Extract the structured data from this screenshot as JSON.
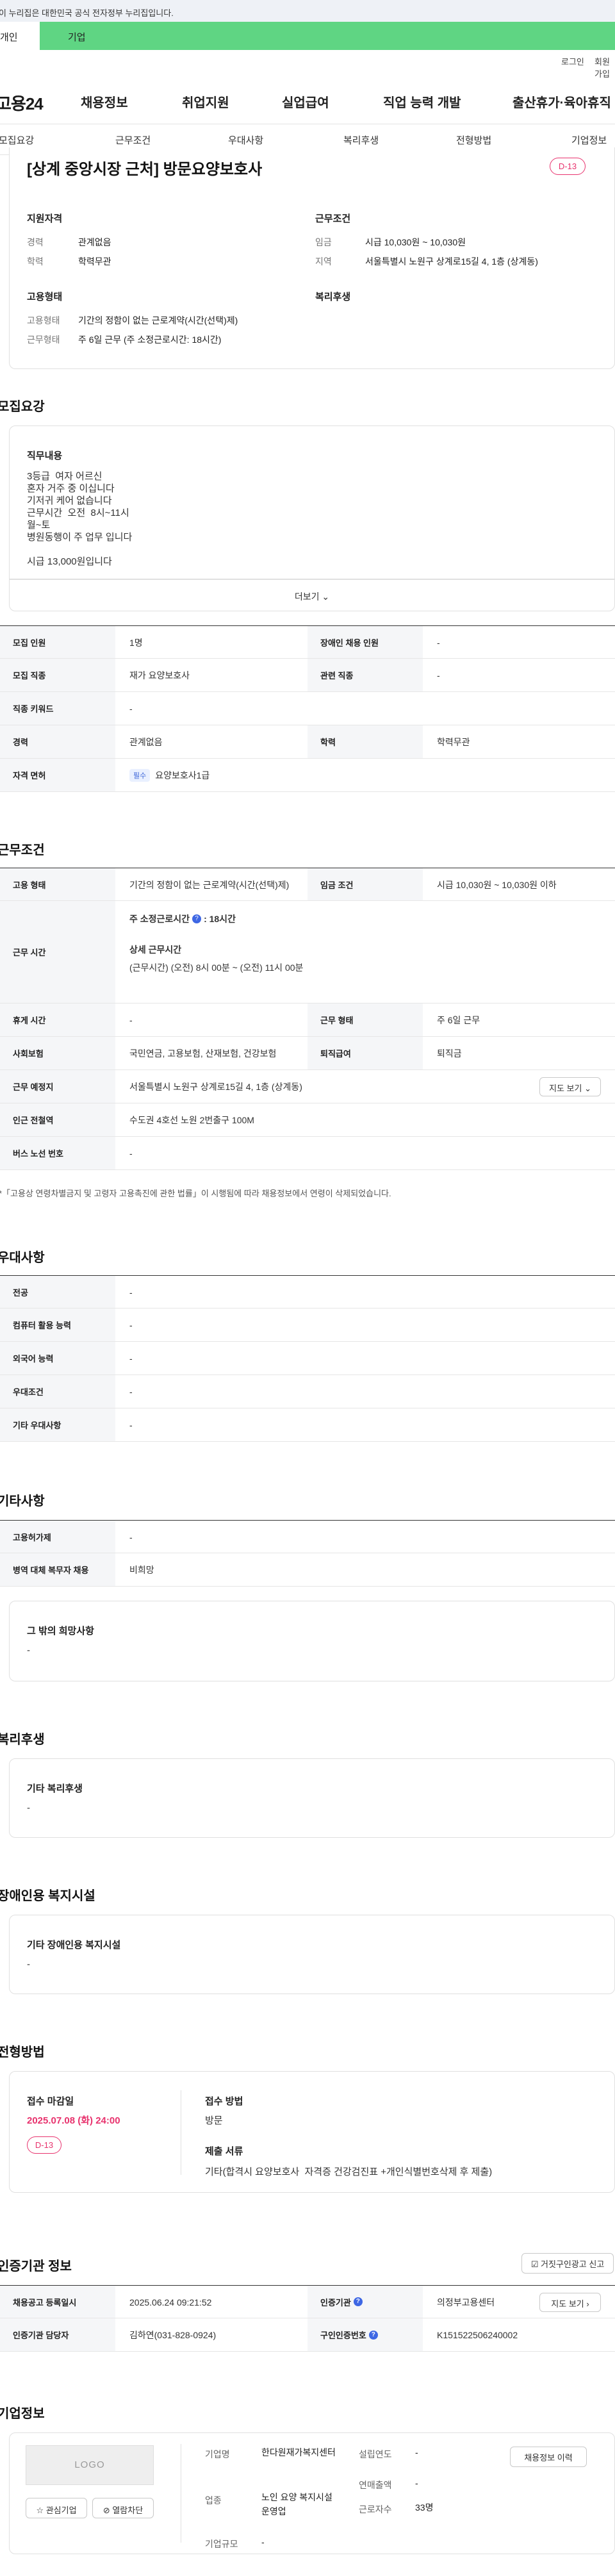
{
  "gov_banner": "이 누리집은 대한민국 공식 전자정부 누리집입니다.",
  "top_tabs": {
    "person": "개인",
    "company": "기업"
  },
  "util": {
    "login": "로그인",
    "join": "회원가입"
  },
  "gnb": {
    "logo": "고용24",
    "menu": [
      "채용정보",
      "취업지원",
      "실업급여",
      "직업 능력 개발",
      "출산휴가·육아휴직"
    ]
  },
  "subnav": [
    "모집요강",
    "근무조건",
    "우대사항",
    "복리후생",
    "전형방법",
    "기업정보"
  ],
  "summary": {
    "title": "[상계 중앙시장 근처] 방문요양보호사",
    "dday": "D-13",
    "qual_h": "지원자격",
    "career_k": "경력",
    "career_v": "관계없음",
    "edu_k": "학력",
    "edu_v": "학력무관",
    "cond_h": "근무조건",
    "wage_k": "임금",
    "wage_v": "시급 10,030원 ~ 10,030원",
    "region_k": "지역",
    "region_v": "서울특별시 노원구 상계로15길 4, 1층 (상계동)",
    "emp_h": "고용형태",
    "emp_type_k": "고용형태",
    "emp_type_v": "기간의 정함이 없는 근로계약(시간(선택)제)",
    "work_type_k": "근무형태",
    "work_type_v": "주 6일 근무 (주 소정근로시간: 18시간)",
    "welfare_h": "복리후생"
  },
  "recruit": {
    "title": "모집요강",
    "job_content_h": "직무내용",
    "job_content": "3등급  여자 어르신\n혼자 거주 중 이십니다\n기저귀 케어 없습니다\n근무시간  오전  8시~11시\n월~토\n병원동행이 주 업무 입니다\n\n시급 13,000원입니다",
    "more": "더보기",
    "rows": {
      "headcount_k": "모집 인원",
      "headcount_v": "1명",
      "disabled_k": "장애인 채용 인원",
      "disabled_v": "-",
      "occupation_k": "모집 직종",
      "occupation_v": "재가 요양보호사",
      "related_k": "관련 직종",
      "related_v": "-",
      "keyword_k": "직종 키워드",
      "keyword_v": "-",
      "career_k": "경력",
      "career_v": "관계없음",
      "edu_k": "학력",
      "edu_v": "학력무관",
      "license_k": "자격 면허",
      "license_badge": "필수",
      "license_v": "요양보호사1급"
    }
  },
  "conditions": {
    "title": "근무조건",
    "emp_k": "고용 형태",
    "emp_v": "기간의 정함이 없는 근로계약(시간(선택)제)",
    "wage_k": "임금 조건",
    "wage_v": "시급 10,030원 ~ 10,030원 이하",
    "hours_k": "근무 시간",
    "weekly_h": "주 소정근로시간",
    "weekly_v": ": 18시간",
    "detail_h": "상세 근무시간",
    "detail_v": "(근무시간) (오전) 8시 00분 ~ (오전) 11시 00분",
    "holiday_k": "휴게 시간",
    "holiday_v": "-",
    "worktype_k": "근무 형태",
    "worktype_v": "주 6일 근무",
    "insurance_k": "사회보험",
    "insurance_v": "국민연금, 고용보험, 산재보험, 건강보험",
    "severance_k": "퇴직급여",
    "severance_v": "퇴직금",
    "place_k": "근무 예정지",
    "place_v": "서울특별시 노원구 상계로15길 4, 1층 (상계동)",
    "map_btn": "지도 보기",
    "station_k": "인근 전철역",
    "station_v": "수도권 4호선 노원 2번출구 100M",
    "bus_k": "버스 노선 번호",
    "bus_v": "-",
    "footnote": "*「고용상 연령차별금지 및 고령자 고용촉진에 관한 법률」이 시행됨에 따라 채용정보에서 연령이 삭제되었습니다."
  },
  "preference": {
    "title": "우대사항",
    "major_k": "전공",
    "major_v": "-",
    "computer_k": "컴퓨터 활용 능력",
    "computer_v": "-",
    "language_k": "외국어 능력",
    "language_v": "-",
    "pref_k": "우대조건",
    "pref_v": "-",
    "other_k": "기타 우대사항",
    "other_v": "-"
  },
  "etc": {
    "title": "기타사항",
    "welfare_k": "고용허가제",
    "welfare_v": "-",
    "military_k": "병역 대체 복무자 채용",
    "military_v": "비희망",
    "other_h": "그 밖의 희망사항",
    "other_v": "-"
  },
  "benefits": {
    "title": "복리후생",
    "box_h": "기타 복리후생",
    "box_v": "-"
  },
  "disability": {
    "title": "장애인용 복지시설",
    "box_h": "기타 장애인용 복지시설",
    "box_v": "-"
  },
  "selection": {
    "title": "전형방법",
    "deadline_h": "접수 마감일",
    "deadline_v": "2025.07.08 (화) 24:00",
    "dday": "D-13",
    "method_h": "접수 방법",
    "method_v": "방문",
    "docs_h": "제출 서류",
    "docs_v": "기타(합격시 요양보호사  자격증 건강검진표 +개인식별번호삭제 후 제출)"
  },
  "agency": {
    "title": "인증기관 정보",
    "report_btn": "거짓구인광고 신고",
    "reg_date_k": "채용공고 등록일시",
    "reg_date_v": "2025.06.24 09:21:52",
    "cert_k": "인증기관",
    "cert_v": "의정부고용센터",
    "cert_btn": "지도 보기",
    "manager_k": "인증기관 담당자",
    "manager_v": "김하연(031-828-0924)",
    "number_k": "구인인증번호",
    "number_v": "K151522506240002"
  },
  "company": {
    "title": "기업정보",
    "logo": "LOGO",
    "interest_btn": "관심기업",
    "block_btn": "열람차단",
    "name_k": "기업명",
    "name_v": "한다원재가복지센터",
    "founded_k": "설립연도",
    "founded_v": "-",
    "sales_k": "연매출액",
    "sales_v": "-",
    "industry_k": "업종",
    "industry_v": "노인 요양 복지시설 운영업",
    "employees_k": "근로자수",
    "employees_v": "33명",
    "size_k": "기업규모",
    "size_v": "-",
    "history_btn": "채용정보 이력"
  }
}
